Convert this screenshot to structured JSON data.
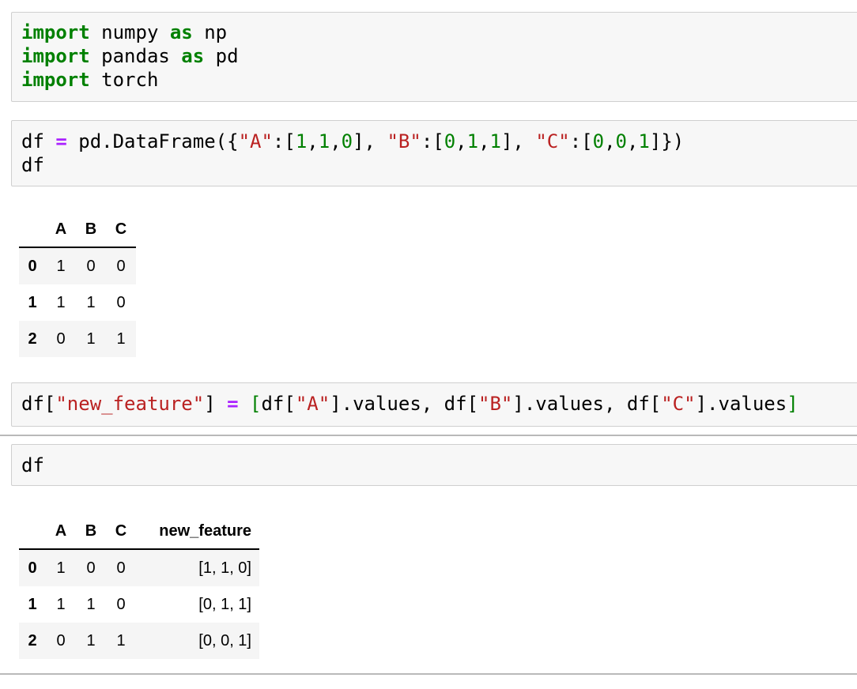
{
  "cell1": {
    "line1": {
      "kw1": "import",
      "mod": " numpy ",
      "kw2": "as",
      "alias": " np"
    },
    "line2": {
      "kw1": "import",
      "mod": " pandas ",
      "kw2": "as",
      "alias": " pd"
    },
    "line3": {
      "kw1": "import",
      "mod": " torch"
    }
  },
  "cell2": {
    "line1": {
      "var": "df ",
      "eq": "=",
      "call": " pd.DataFrame({",
      "kA": "\"A\"",
      "open1": ":[",
      "a1": "1",
      "c1": ",",
      "a2": "1",
      "c2": ",",
      "a3": "0",
      "close1": "], ",
      "kB": "\"B\"",
      "open2": ":[",
      "b1": "0",
      "c3": ",",
      "b2": "1",
      "c4": ",",
      "b3": "1",
      "close2": "], ",
      "kC": "\"C\"",
      "open3": ":[",
      "cc1": "0",
      "c5": ",",
      "cc2": "0",
      "c6": ",",
      "cc3": "1",
      "close3": "]})"
    },
    "line2": "df"
  },
  "table1": {
    "columns": [
      "A",
      "B",
      "C"
    ],
    "rows": [
      {
        "index": "0",
        "values": [
          "1",
          "0",
          "0"
        ]
      },
      {
        "index": "1",
        "values": [
          "1",
          "1",
          "0"
        ]
      },
      {
        "index": "2",
        "values": [
          "0",
          "1",
          "1"
        ]
      }
    ]
  },
  "cell3": {
    "p1": "df[",
    "s1": "\"new_feature\"",
    "p2": "] ",
    "eq": "=",
    "sp": " ",
    "lb": "[",
    "p3": "df[",
    "s2": "\"A\"",
    "p4": "].values, df[",
    "s3": "\"B\"",
    "p5": "].values, df[",
    "s4": "\"C\"",
    "p6": "].values",
    "rb": "]"
  },
  "cell4": {
    "line1": "df"
  },
  "table2": {
    "columns": [
      "A",
      "B",
      "C",
      "new_feature"
    ],
    "rows": [
      {
        "index": "0",
        "values": [
          "1",
          "0",
          "0",
          "[1, 1, 0]"
        ]
      },
      {
        "index": "1",
        "values": [
          "1",
          "1",
          "0",
          "[0, 1, 1]"
        ]
      },
      {
        "index": "2",
        "values": [
          "0",
          "1",
          "1",
          "[0, 0, 1]"
        ]
      }
    ]
  },
  "colors": {
    "keyword": "#008000",
    "operator": "#aa22ff",
    "string": "#ba2121",
    "cell_background": "#f7f7f7"
  }
}
